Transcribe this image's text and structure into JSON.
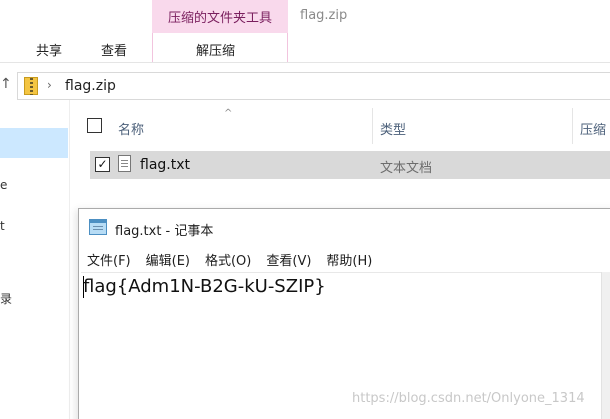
{
  "explorer": {
    "context_tab": "压缩的文件夹工具",
    "context_action": "解压缩",
    "window_title": "flag.zip",
    "ribbon_tabs": [
      {
        "label": "共享"
      },
      {
        "label": "查看"
      }
    ],
    "address": {
      "up_glyph": "↑",
      "chevron": "›",
      "path": "flag.zip"
    },
    "nav_fragments": [
      "e",
      "t",
      "录"
    ],
    "columns": {
      "name": "名称",
      "type": "类型",
      "size": "压缩"
    },
    "sort_glyph": "^",
    "files": [
      {
        "name": "flag.txt",
        "type": "文本文档",
        "check": "✓"
      }
    ]
  },
  "notepad": {
    "title": "flag.txt - 记事本",
    "menu": [
      "文件(F)",
      "编辑(E)",
      "格式(O)",
      "查看(V)",
      "帮助(H)"
    ],
    "content": "flag{Adm1N-B2G-kU-SZIP}"
  },
  "watermark": "https://blog.csdn.net/Onlyone_1314"
}
